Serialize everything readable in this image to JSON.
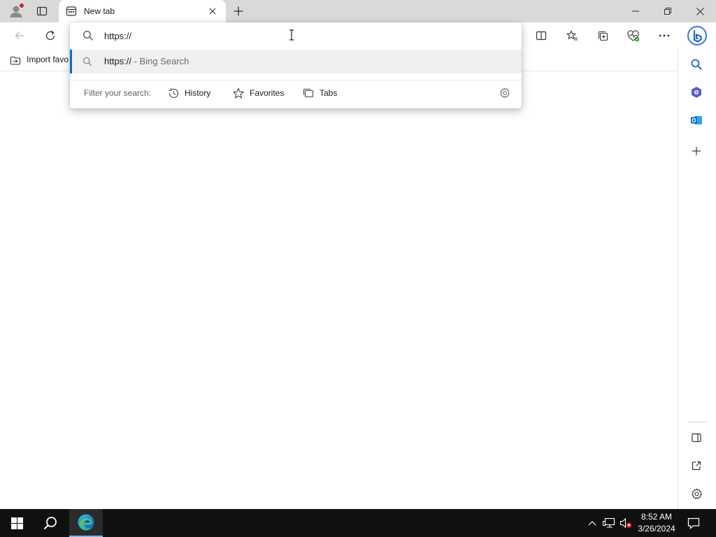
{
  "browser": {
    "tab": {
      "title": "New tab"
    },
    "bookmarks_bar": {
      "import_label": "Import favo"
    }
  },
  "address_dropdown": {
    "input_value": "https://",
    "suggestion": {
      "query": "https://",
      "suffix": " - Bing Search"
    },
    "filter": {
      "label": "Filter your search:",
      "options": [
        "History",
        "Favorites",
        "Tabs"
      ]
    }
  },
  "taskbar": {
    "time": "8:52 AM",
    "date": "3/26/2024"
  },
  "colors": {
    "accent": "#0f6cbd",
    "titlebar": "#d9d9d9",
    "taskbar": "#101010"
  }
}
